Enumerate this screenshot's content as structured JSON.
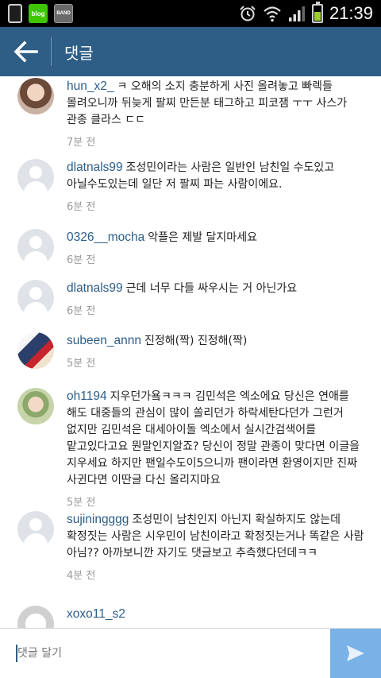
{
  "status_bar": {
    "time": "21:39",
    "app_labels": {
      "blog": "blog",
      "band": "BAND"
    }
  },
  "header": {
    "title": "댓글"
  },
  "comments": [
    {
      "username": "hun_x2_",
      "text": "ㅋ 오해의 소지 충분하게 사진 올려놓고 빠렉들 몰려오니까 뒤늦게 팔찌 만든분 태그하고 피코잼 ㅜㅜ 사스가 관종 클라스 ㄷㄷ",
      "time": "7분 전"
    },
    {
      "username": "dlatnals99",
      "text": "조성민이라는 사람은 일반인 남친일 수도있고 아닐수도있는데 일단 저 팔찌 파는 사람이에요.",
      "time": "6분 전"
    },
    {
      "username": "0326__mocha",
      "text": "악플은 제발 달지마세요",
      "time": "6분 전"
    },
    {
      "username": "dlatnals99",
      "text": "근데 너무 다들 싸우시는 거 아닌가요",
      "time": "6분 전"
    },
    {
      "username": "subeen_annn",
      "text": "진정해(짝) 진정해(짝)",
      "time": "5분 전"
    },
    {
      "username": "oh1194",
      "text": "지우던가욬ㅋㅋㅋ 김민석은 엑소에요 당신은 연애를 해도 대중들의 관심이 많이 쏠리던가 하락세탄다던가 그런거 없지만 김민석은 대세아이돌 엑소에서 실시간검색어를 맡고있다고요 뭔말인지알죠? 당신이 정말 관종이 맞다면 이글을 지우세요 하지만 팬일수도이5으니까 팬이라면 환영이지만 진짜 사귄다면 이딴글 다신 올리지마요",
      "time": "5분 전"
    },
    {
      "username": "sujiningggg",
      "text": "조성민이 남친인지 아닌지 확실하지도 않는데 확정짓는 사람은 시우민이 남친이라고 확정짓는거나 똑같은 사람 아님?? 아까보니깐 자기도 댓글보고 추측했다던데ㅋㅋ",
      "time": "4분 전"
    },
    {
      "username": "xoxo11_s2",
      "text": "",
      "time": ""
    }
  ],
  "input": {
    "placeholder": "댓글 달기"
  },
  "colors": {
    "header_bg": "#2e5e86",
    "username": "#2b5d8a",
    "send_bg": "#78b2e6"
  },
  "icons": {
    "back": "arrow-left-icon",
    "send": "send-icon"
  }
}
